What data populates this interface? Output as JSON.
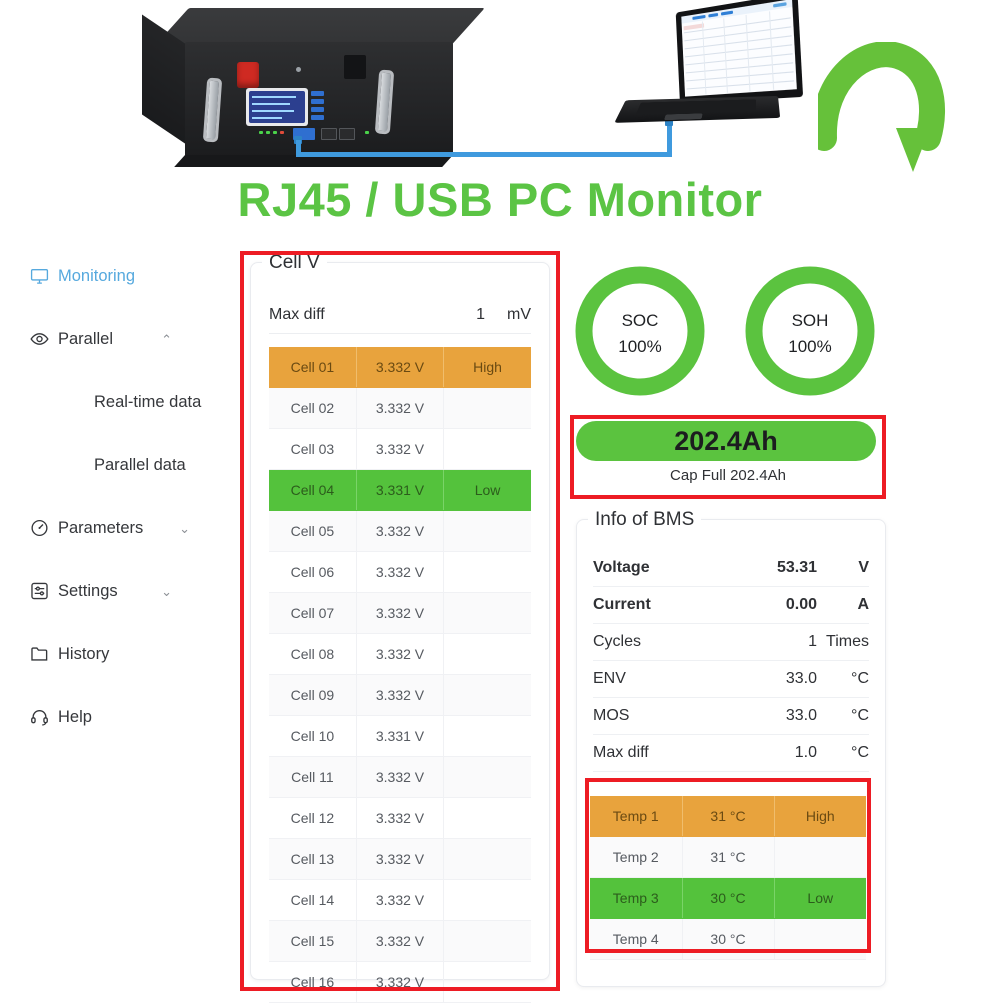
{
  "hero": {
    "title": "RJ45 / USB PC Monitor",
    "title_color": "#5bc444",
    "battery_label": "battery-rack-unit",
    "laptop_label": "laptop-device",
    "arrow_label": "green-curved-arrow",
    "cable_label": "blue-connection-cable"
  },
  "sidebar": {
    "items": [
      {
        "label": "Monitoring",
        "icon": "monitor-icon",
        "active": true,
        "caret": "",
        "sub": false
      },
      {
        "label": "Parallel",
        "icon": "eye-icon",
        "active": false,
        "caret": "⌃",
        "sub": false
      },
      {
        "label": "Real-time data",
        "icon": "",
        "active": false,
        "caret": "",
        "sub": true
      },
      {
        "label": "Parallel data",
        "icon": "",
        "active": false,
        "caret": "",
        "sub": true
      },
      {
        "label": "Parameters",
        "icon": "gauge-icon",
        "active": false,
        "caret": "⌄",
        "sub": false
      },
      {
        "label": "Settings",
        "icon": "sliders-icon",
        "active": false,
        "caret": "⌄",
        "sub": false
      },
      {
        "label": "History",
        "icon": "folder-icon",
        "active": false,
        "caret": "",
        "sub": false
      },
      {
        "label": "Help",
        "icon": "headset-icon",
        "active": false,
        "caret": "",
        "sub": false
      }
    ]
  },
  "cell_panel": {
    "legend": "Cell V",
    "max_diff": {
      "label": "Max diff",
      "value": "1",
      "unit": "mV"
    },
    "rows": [
      {
        "name": "Cell 01",
        "voltage": "3.332 V",
        "status": "High",
        "state": "hi"
      },
      {
        "name": "Cell 02",
        "voltage": "3.332 V",
        "status": "",
        "state": "zebra"
      },
      {
        "name": "Cell 03",
        "voltage": "3.332 V",
        "status": "",
        "state": ""
      },
      {
        "name": "Cell 04",
        "voltage": "3.331 V",
        "status": "Low",
        "state": "lo"
      },
      {
        "name": "Cell 05",
        "voltage": "3.332 V",
        "status": "",
        "state": "zebra"
      },
      {
        "name": "Cell 06",
        "voltage": "3.332 V",
        "status": "",
        "state": ""
      },
      {
        "name": "Cell 07",
        "voltage": "3.332 V",
        "status": "",
        "state": "zebra"
      },
      {
        "name": "Cell 08",
        "voltage": "3.332 V",
        "status": "",
        "state": ""
      },
      {
        "name": "Cell 09",
        "voltage": "3.332 V",
        "status": "",
        "state": "zebra"
      },
      {
        "name": "Cell 10",
        "voltage": "3.331 V",
        "status": "",
        "state": ""
      },
      {
        "name": "Cell 11",
        "voltage": "3.332 V",
        "status": "",
        "state": "zebra"
      },
      {
        "name": "Cell 12",
        "voltage": "3.332 V",
        "status": "",
        "state": ""
      },
      {
        "name": "Cell 13",
        "voltage": "3.332 V",
        "status": "",
        "state": "zebra"
      },
      {
        "name": "Cell 14",
        "voltage": "3.332 V",
        "status": "",
        "state": ""
      },
      {
        "name": "Cell 15",
        "voltage": "3.332 V",
        "status": "",
        "state": "zebra"
      },
      {
        "name": "Cell 16",
        "voltage": "3.332 V",
        "status": "",
        "state": ""
      }
    ]
  },
  "gauges": [
    {
      "name": "SOC",
      "value": "100%",
      "percent": 100,
      "color": "#5bc33f"
    },
    {
      "name": "SOH",
      "value": "100%",
      "percent": 100,
      "color": "#5bc33f"
    }
  ],
  "capacity": {
    "bar_value": "202.4Ah",
    "sub_text": "Cap Full  202.4Ah",
    "bar_color": "#5bc33f",
    "percent": 100
  },
  "bms": {
    "legend": "Info of BMS",
    "rows": [
      {
        "key": "Voltage",
        "value": "53.31",
        "unit": "V",
        "bold": true
      },
      {
        "key": "Current",
        "value": "0.00",
        "unit": "A",
        "bold": true
      },
      {
        "key": "Cycles",
        "value": "1",
        "unit": "Times",
        "bold": false
      },
      {
        "key": "ENV",
        "value": "33.0",
        "unit": "°C",
        "bold": false
      },
      {
        "key": "MOS",
        "value": "33.0",
        "unit": "°C",
        "bold": false
      },
      {
        "key": "Max diff",
        "value": "1.0",
        "unit": "°C",
        "bold": false
      }
    ]
  },
  "temps": {
    "rows": [
      {
        "name": "Temp 1",
        "value": "31 °C",
        "status": "High",
        "state": "hi"
      },
      {
        "name": "Temp 2",
        "value": "31 °C",
        "status": "",
        "state": "zebra"
      },
      {
        "name": "Temp 3",
        "value": "30 °C",
        "status": "Low",
        "state": "lo"
      },
      {
        "name": "Temp 4",
        "value": "30 °C",
        "status": "",
        "state": "zebra"
      }
    ]
  },
  "annotations": {
    "color": "#ed1c24",
    "boxes": [
      "cell-v-panel",
      "capacity-bar",
      "temperature-table"
    ]
  }
}
